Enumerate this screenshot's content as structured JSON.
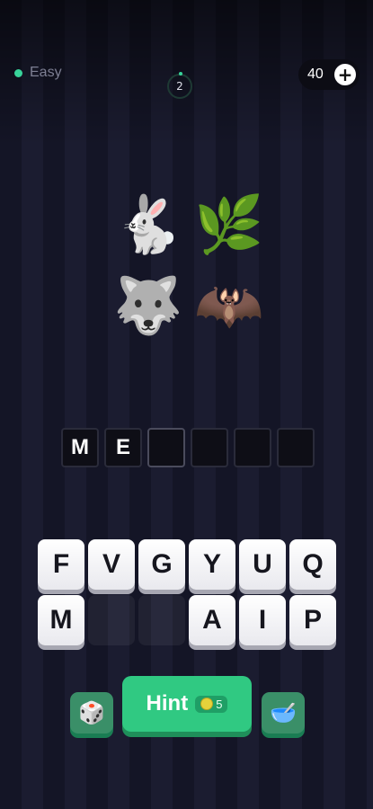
{
  "header": {
    "difficulty": "Easy",
    "level": "2",
    "coins": "40",
    "add_icon": "+"
  },
  "puzzle": {
    "emojis": [
      {
        "name": "rabbit",
        "glyph": "🐇"
      },
      {
        "name": "herb",
        "glyph": "🌿"
      },
      {
        "name": "wolf",
        "glyph": "🐺"
      },
      {
        "name": "bat",
        "glyph": "🦇"
      }
    ],
    "answer_slots": [
      "M",
      "E",
      "",
      "",
      "",
      ""
    ]
  },
  "keyboard": {
    "keys": [
      "F",
      "V",
      "G",
      "Y",
      "U",
      "Q",
      "M",
      "",
      "",
      "A",
      "I",
      "P"
    ]
  },
  "actions": {
    "hint_label": "Hint",
    "hint_cost": "5",
    "left_icon": "🎲",
    "right_icon": "🥣"
  },
  "colors": {
    "accent": "#30c982",
    "background": "#141526"
  }
}
